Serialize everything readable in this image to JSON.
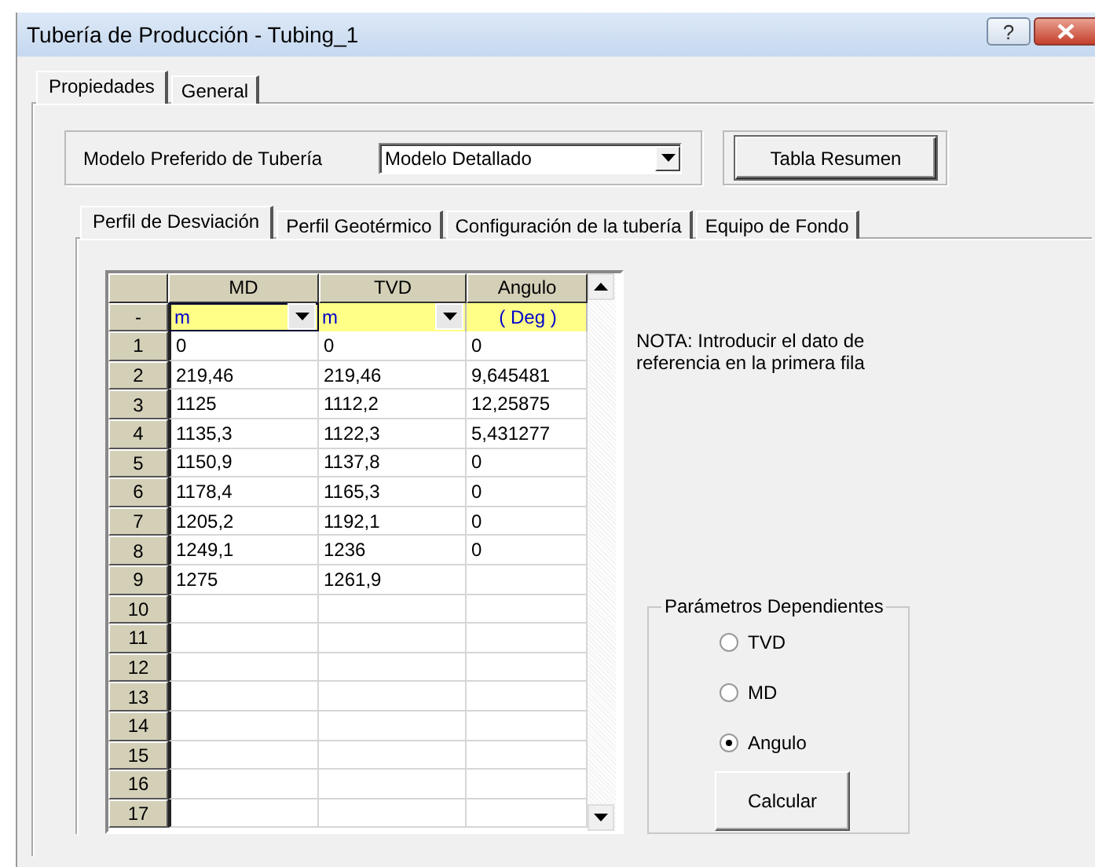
{
  "window": {
    "title": "Tubería de Producción - Tubing_1",
    "controls": [
      {
        "kind": "help",
        "label": "?"
      },
      {
        "kind": "close"
      }
    ]
  },
  "outer_tabs": [
    {
      "label": "Propiedades",
      "selected": true
    },
    {
      "label": "General",
      "selected": false
    }
  ],
  "model": {
    "label": "Modelo Preferido de Tubería",
    "value": "Modelo Detallado"
  },
  "summary_button": "Tabla Resumen",
  "inner_tabs": [
    {
      "label": "Perfil de Desviación",
      "selected": true
    },
    {
      "label": "Perfil Geotérmico",
      "selected": false
    },
    {
      "label": "Configuración de la tubería",
      "selected": false
    },
    {
      "label": "Equipo de Fondo",
      "selected": false
    }
  ],
  "grid": {
    "unit_row_header": "-",
    "columns": [
      {
        "header": "MD",
        "unit": "m",
        "kind": "dropdown"
      },
      {
        "header": "TVD",
        "unit": "m",
        "kind": "dropdown"
      },
      {
        "header": "Angulo",
        "unit": "( Deg )",
        "kind": "fixed"
      }
    ],
    "rows": [
      {
        "number": "1",
        "cells": [
          "0",
          "0",
          "0"
        ]
      },
      {
        "number": "2",
        "cells": [
          "219,46",
          "219,46",
          "9,645481"
        ]
      },
      {
        "number": "3",
        "cells": [
          "1125",
          "1112,2",
          "12,25875"
        ]
      },
      {
        "number": "4",
        "cells": [
          "1135,3",
          "1122,3",
          "5,431277"
        ]
      },
      {
        "number": "5",
        "cells": [
          "1150,9",
          "1137,8",
          "0"
        ]
      },
      {
        "number": "6",
        "cells": [
          "1178,4",
          "1165,3",
          "0"
        ]
      },
      {
        "number": "7",
        "cells": [
          "1205,2",
          "1192,1",
          "0"
        ]
      },
      {
        "number": "8",
        "cells": [
          "1249,1",
          "1236",
          "0"
        ]
      },
      {
        "number": "9",
        "cells": [
          "1275",
          "1261,9"
        ]
      },
      {
        "number": "10"
      },
      {
        "number": "11"
      },
      {
        "number": "12"
      },
      {
        "number": "13"
      },
      {
        "number": "14"
      },
      {
        "number": "15"
      },
      {
        "number": "16"
      },
      {
        "number": "17"
      }
    ]
  },
  "note": "NOTA: Introducir el dato de referencia en la primera fila",
  "dependent_parameters": {
    "title": "Parámetros Dependientes",
    "options": [
      {
        "label": "TVD",
        "selected": false
      },
      {
        "label": "MD",
        "selected": false
      },
      {
        "label": "Angulo",
        "selected": true
      }
    ],
    "button": "Calcular"
  }
}
